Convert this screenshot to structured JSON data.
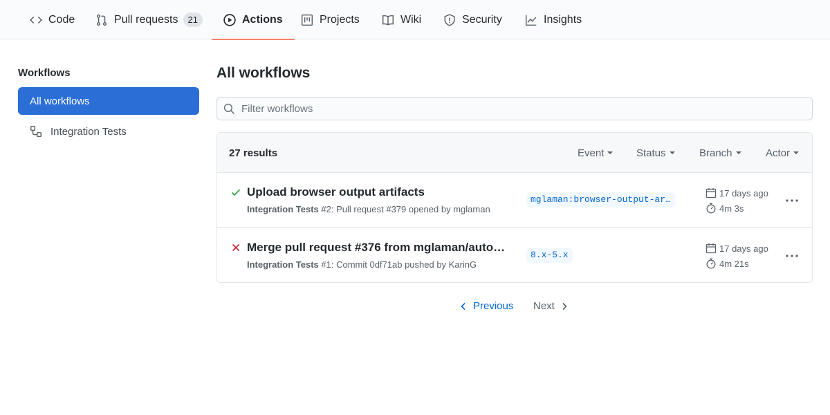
{
  "tabs": [
    {
      "label": "Code",
      "icon": "code-icon"
    },
    {
      "label": "Pull requests",
      "icon": "git-pull-request-icon",
      "count": "21"
    },
    {
      "label": "Actions",
      "icon": "play-icon",
      "active": true
    },
    {
      "label": "Projects",
      "icon": "project-icon"
    },
    {
      "label": "Wiki",
      "icon": "book-icon"
    },
    {
      "label": "Security",
      "icon": "shield-icon"
    },
    {
      "label": "Insights",
      "icon": "graph-icon"
    }
  ],
  "sidebar": {
    "title": "Workflows",
    "items": [
      {
        "label": "All workflows",
        "active": true
      },
      {
        "label": "Integration Tests",
        "icon": "workflow-icon"
      }
    ]
  },
  "main": {
    "title": "All workflows",
    "filter_placeholder": "Filter workflows",
    "results_label": "27 results",
    "filters": [
      "Event",
      "Status",
      "Branch",
      "Actor"
    ],
    "runs": [
      {
        "status": "success",
        "title": "Upload browser output artifacts",
        "workflow": "Integration Tests",
        "detail": " #2: Pull request #379 opened by mglaman",
        "branch": "mglaman:browser-output-ar…",
        "date": "17 days ago",
        "duration": "4m 3s"
      },
      {
        "status": "failure",
        "title": "Merge pull request #376 from mglaman/auto…",
        "workflow": "Integration Tests",
        "detail": " #1: Commit 0df71ab pushed by KarinG",
        "branch": "8.x-5.x",
        "date": "17 days ago",
        "duration": "4m 21s"
      }
    ]
  },
  "pagination": {
    "previous": "Previous",
    "next": "Next"
  },
  "colors": {
    "accent": "#2b6fd6",
    "link": "#0366d6",
    "success": "#28a745",
    "failure": "#cb2431",
    "tab_underline": "#f9826c"
  }
}
